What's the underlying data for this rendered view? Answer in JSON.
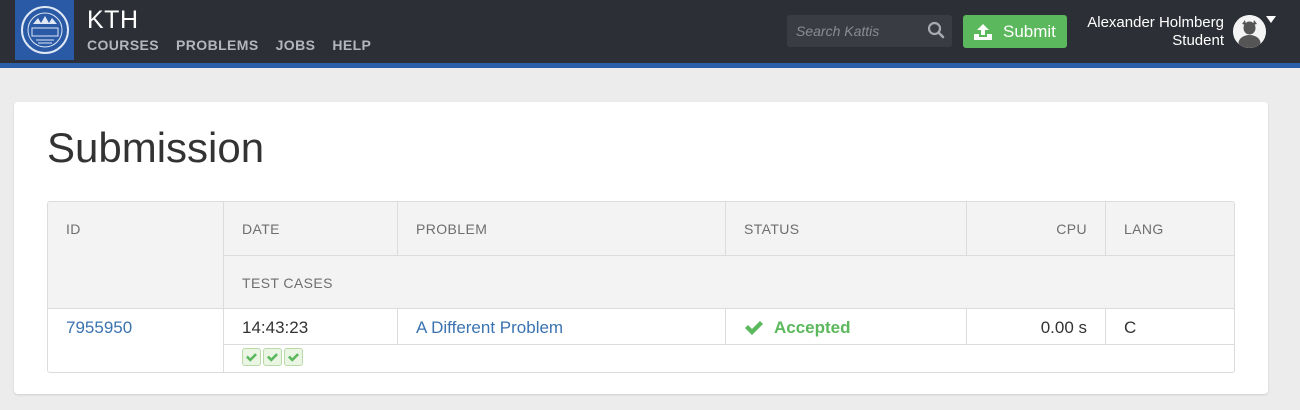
{
  "header": {
    "brand": "KTH",
    "nav": [
      {
        "label": "COURSES"
      },
      {
        "label": "PROBLEMS"
      },
      {
        "label": "JOBS"
      },
      {
        "label": "HELP"
      }
    ],
    "search_placeholder": "Search Kattis",
    "submit_label": "Submit",
    "user_name": "Alexander Holmberg",
    "user_role": "Student"
  },
  "page": {
    "title": "Submission"
  },
  "table": {
    "headers": {
      "id": "ID",
      "date": "DATE",
      "problem": "PROBLEM",
      "status": "STATUS",
      "cpu": "CPU",
      "lang": "LANG",
      "test_cases": "TEST CASES"
    },
    "row": {
      "id": "7955950",
      "date": "14:43:23",
      "problem": "A Different Problem",
      "status": "Accepted",
      "cpu": "0.00 s",
      "lang": "C",
      "test_cases": [
        "passed",
        "passed",
        "passed"
      ]
    }
  },
  "colors": {
    "accent_green": "#5cb85c",
    "link_blue": "#3a73b0",
    "topbar": "#2d2f36",
    "stripe": "#2b5ea8"
  },
  "icons": {
    "logo": "kth-logo-icon",
    "search": "search-icon",
    "submit": "upload-icon",
    "status": "check-icon",
    "test_case": "check-icon"
  }
}
